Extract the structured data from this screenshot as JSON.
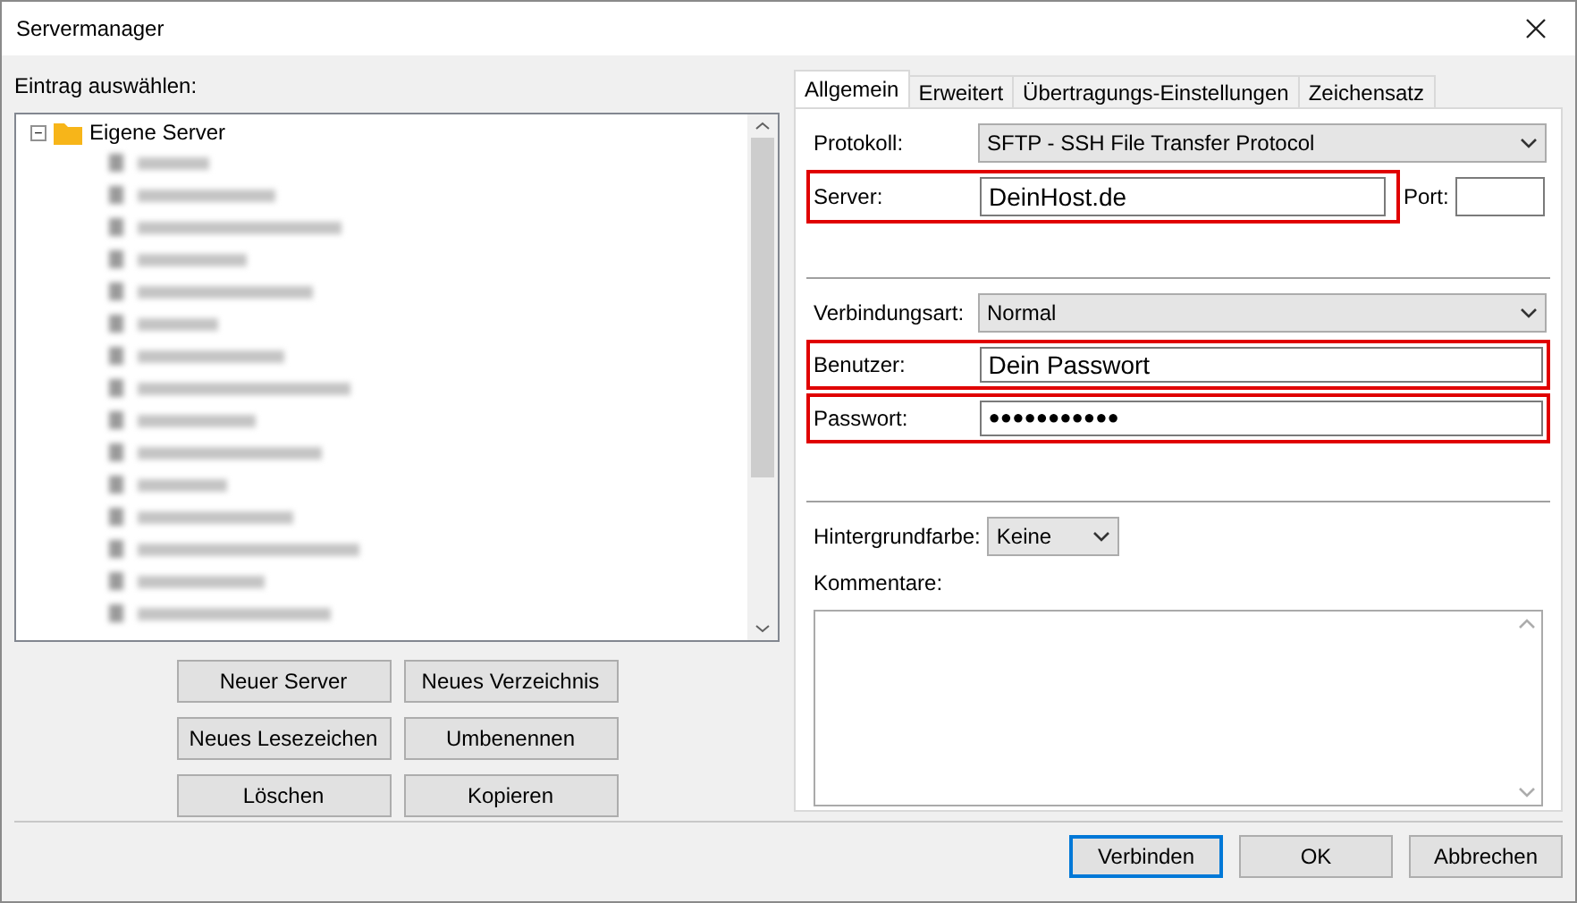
{
  "window": {
    "title": "Servermanager"
  },
  "left": {
    "label": "Eintrag auswählen:",
    "tree": {
      "label": "Eigene Server",
      "expanded": true,
      "expander": "−",
      "children": [
        {
          "kind": "redacted"
        },
        {
          "kind": "redacted"
        },
        {
          "kind": "redacted"
        },
        {
          "kind": "redacted"
        },
        {
          "kind": "redacted"
        },
        {
          "kind": "redacted"
        },
        {
          "kind": "redacted"
        },
        {
          "kind": "redacted"
        },
        {
          "kind": "redacted"
        },
        {
          "kind": "redacted"
        },
        {
          "kind": "redacted"
        },
        {
          "kind": "redacted"
        },
        {
          "kind": "redacted"
        },
        {
          "kind": "redacted"
        },
        {
          "kind": "redacted"
        }
      ]
    },
    "buttons": [
      "Neuer Server",
      "Neues Verzeichnis",
      "Neues Lesezeichen",
      "Umbenennen",
      "Löschen",
      "Kopieren"
    ]
  },
  "tabs": [
    {
      "label": "Allgemein",
      "selected": true
    },
    {
      "label": "Erweitert",
      "selected": false
    },
    {
      "label": "Übertragungs-Einstellungen",
      "selected": false
    },
    {
      "label": "Zeichensatz",
      "selected": false
    }
  ],
  "general": {
    "protocol": {
      "label": "Protokoll:",
      "value": "SFTP - SSH File Transfer Protocol"
    },
    "server": {
      "label": "Server:",
      "value": "DeinHost.de",
      "highlighted": true
    },
    "port": {
      "label": "Port:"
    },
    "logon": {
      "label": "Verbindungsart:",
      "value": "Normal"
    },
    "user": {
      "label": "Benutzer:",
      "value": "Dein Passwort",
      "highlighted": true
    },
    "password": {
      "label": "Passwort:",
      "value": "●●●●●●●●●●●",
      "highlighted": true
    },
    "background": {
      "label": "Hintergrundfarbe:",
      "value": "Keine"
    },
    "comments": {
      "label": "Kommentare:"
    }
  },
  "footer": [
    {
      "label": "Verbinden",
      "selected": true
    },
    {
      "label": "OK",
      "selected": false
    },
    {
      "label": "Abbrechen",
      "selected": false
    }
  ]
}
